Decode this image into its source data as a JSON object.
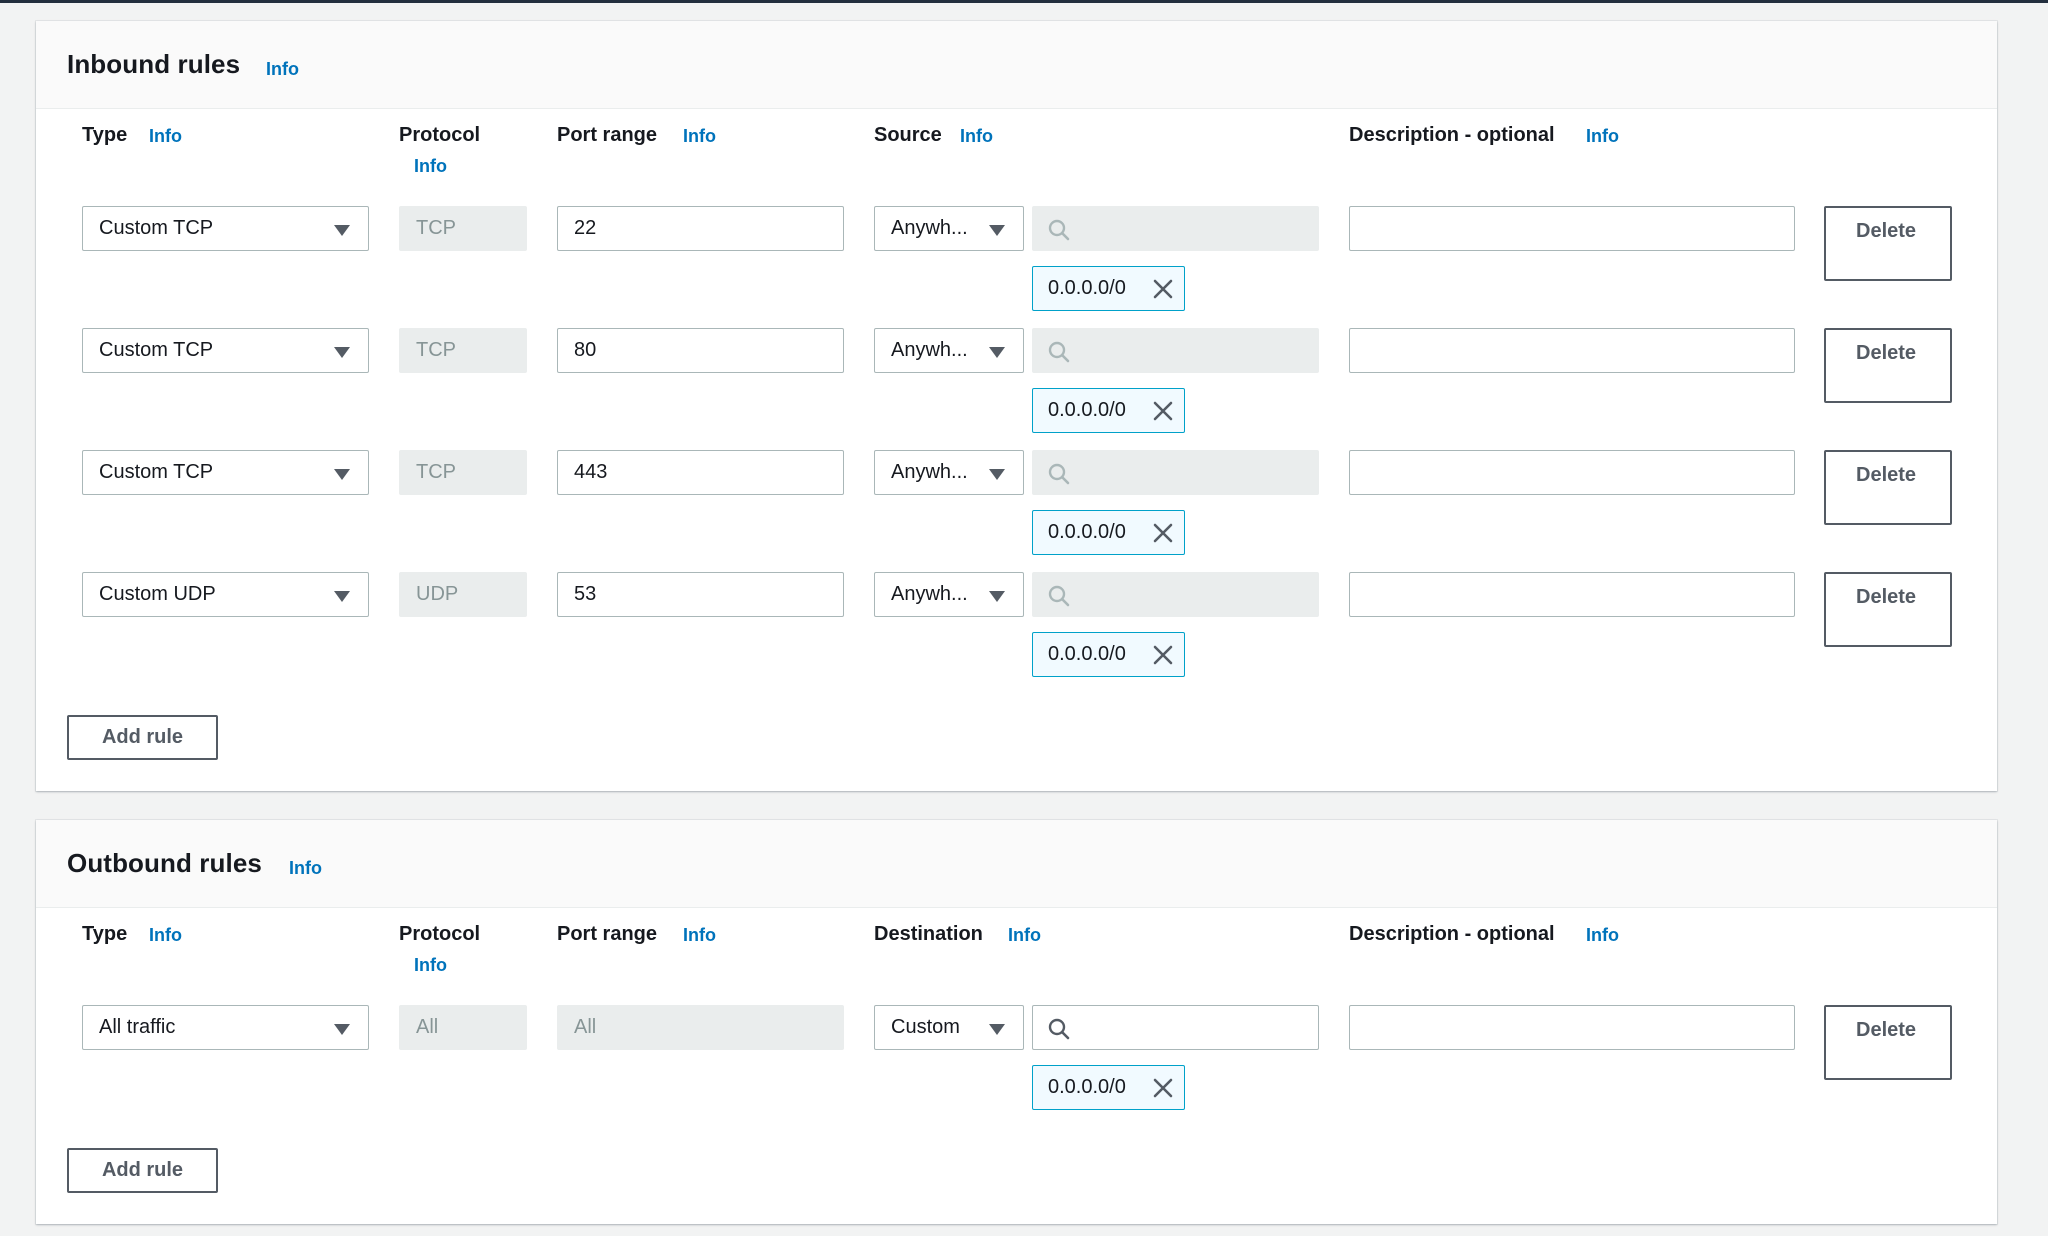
{
  "inbound": {
    "title": "Inbound rules",
    "info": "Info",
    "headers": {
      "type": "Type",
      "protocol": "Protocol",
      "port_range": "Port range",
      "source": "Source",
      "description": "Description - optional"
    },
    "rules": [
      {
        "type": "Custom TCP",
        "protocol": "TCP",
        "port": "22",
        "source": "Anywh...",
        "cidr": "0.0.0.0/0",
        "description": "",
        "delete_label": "Delete"
      },
      {
        "type": "Custom TCP",
        "protocol": "TCP",
        "port": "80",
        "source": "Anywh...",
        "cidr": "0.0.0.0/0",
        "description": "",
        "delete_label": "Delete"
      },
      {
        "type": "Custom TCP",
        "protocol": "TCP",
        "port": "443",
        "source": "Anywh...",
        "cidr": "0.0.0.0/0",
        "description": "",
        "delete_label": "Delete"
      },
      {
        "type": "Custom UDP",
        "protocol": "UDP",
        "port": "53",
        "source": "Anywh...",
        "cidr": "0.0.0.0/0",
        "description": "",
        "delete_label": "Delete"
      }
    ],
    "add_rule_label": "Add rule"
  },
  "outbound": {
    "title": "Outbound rules",
    "info": "Info",
    "headers": {
      "type": "Type",
      "protocol": "Protocol",
      "port_range": "Port range",
      "destination": "Destination",
      "description": "Description - optional"
    },
    "rules": [
      {
        "type": "All traffic",
        "protocol": "All",
        "port": "All",
        "destination": "Custom",
        "cidr": "0.0.0.0/0",
        "description": "",
        "delete_label": "Delete"
      }
    ],
    "add_rule_label": "Add rule"
  },
  "icons": {
    "dropdown": "caret-down-icon",
    "search": "search-icon",
    "remove": "close-icon"
  },
  "colors": {
    "link": "#0073bb",
    "token_border": "#00a1c9",
    "token_bg": "#f1faff",
    "disabled_bg": "#eaeded",
    "header_bar": "#232f3e"
  }
}
